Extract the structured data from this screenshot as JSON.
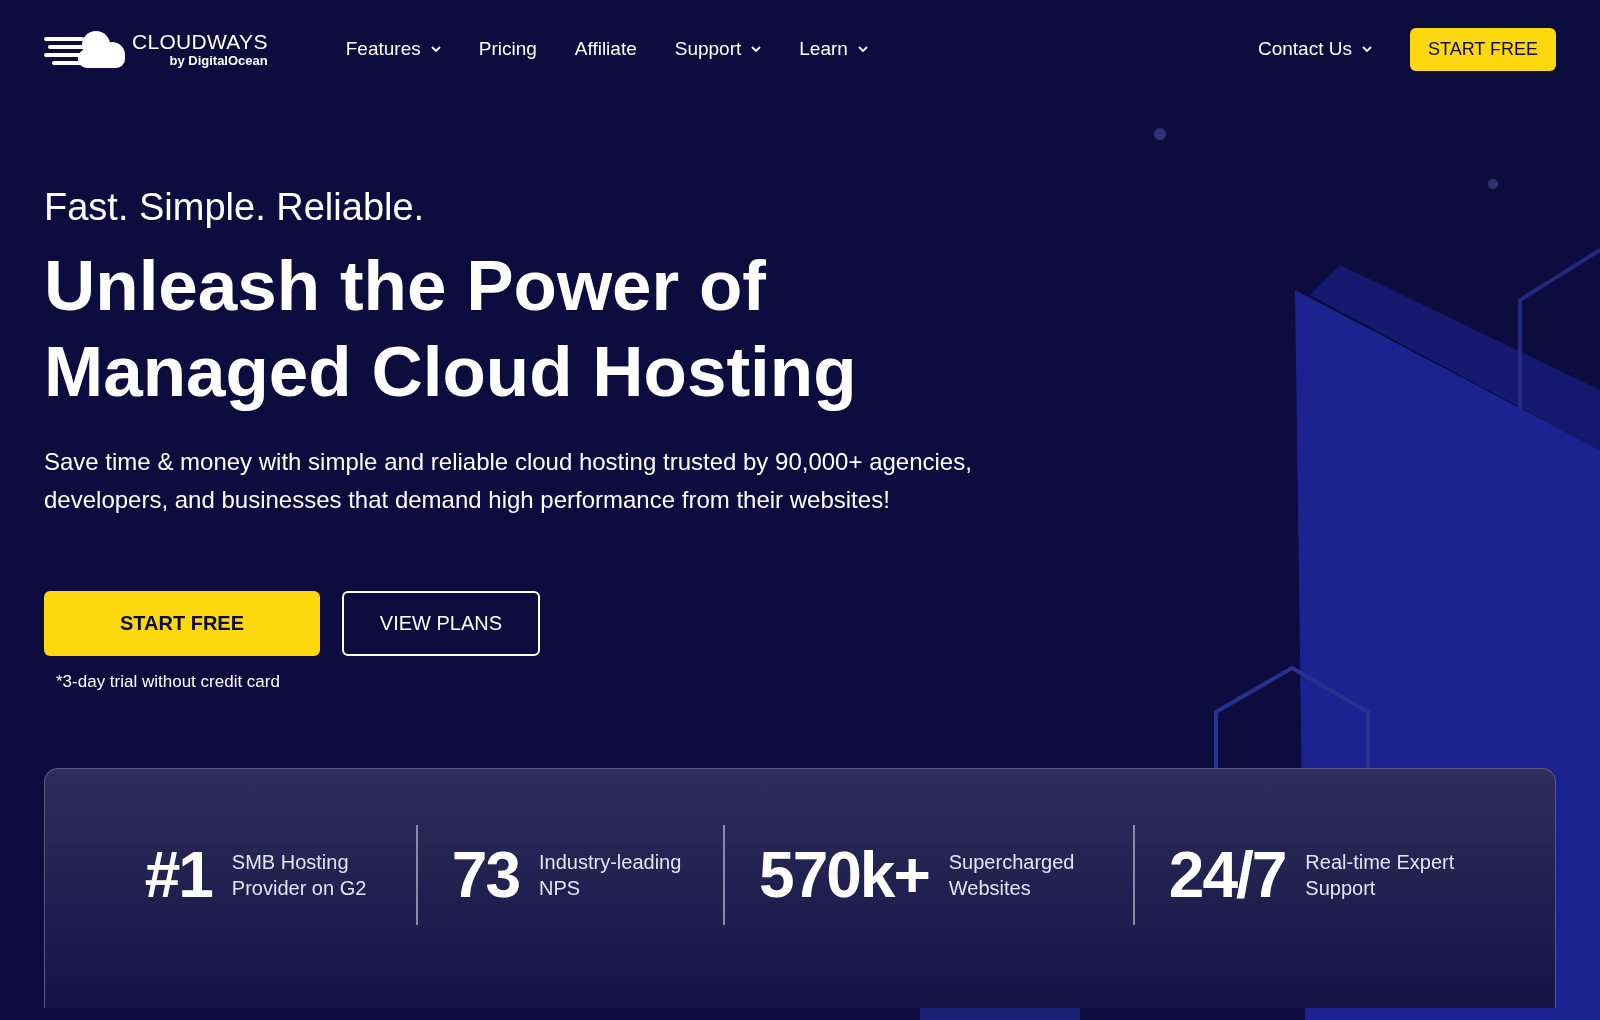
{
  "logo": {
    "name": "CLOUDWAYS",
    "byline": "by DigitalOcean"
  },
  "nav": [
    {
      "label": "Features",
      "dropdown": true
    },
    {
      "label": "Pricing",
      "dropdown": false
    },
    {
      "label": "Affiliate",
      "dropdown": false
    },
    {
      "label": "Support",
      "dropdown": true
    },
    {
      "label": "Learn",
      "dropdown": true
    }
  ],
  "contact": {
    "label": "Contact Us",
    "dropdown": true
  },
  "header_button": "START FREE",
  "hero": {
    "tagline": "Fast. Simple. Reliable.",
    "headline": "Unleash the Power of Managed Cloud Hosting",
    "description": "Save time & money with simple and reliable cloud hosting trusted by 90,000+ agencies, developers, and businesses that demand high performance from their websites!",
    "primary_button": "START FREE",
    "secondary_button": "VIEW PLANS",
    "note": "*3-day trial without credit card"
  },
  "stats": [
    {
      "value": "#1",
      "label": "SMB Hosting Provider on G2"
    },
    {
      "value": "73",
      "label": "Industry-leading NPS"
    },
    {
      "value": "570k+",
      "label": "Supercharged Websites"
    },
    {
      "value": "24/7",
      "label": "Real-time Expert Support"
    }
  ]
}
